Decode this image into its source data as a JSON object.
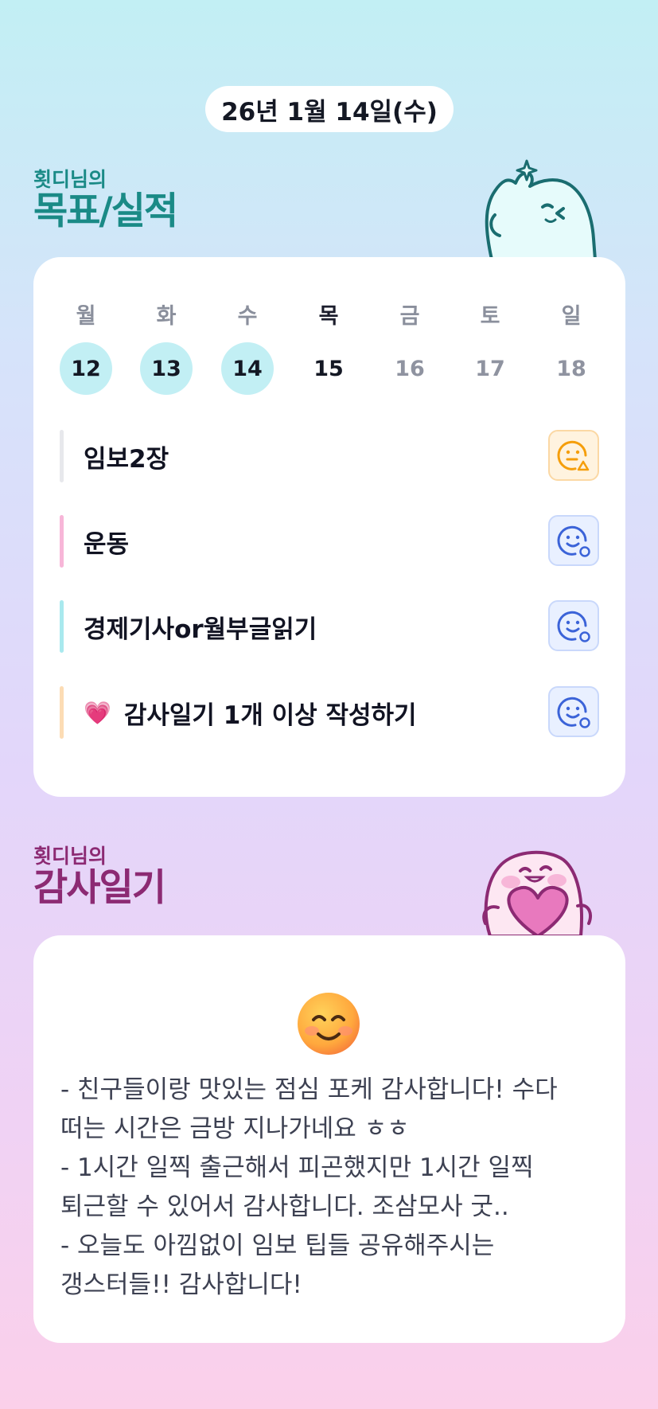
{
  "header": {
    "date": "26년 1월 14일(수)"
  },
  "goals_section": {
    "owner": "횟디님의",
    "title": "목표/실적"
  },
  "week": {
    "days": [
      {
        "name": "월",
        "num": "12",
        "state": "done"
      },
      {
        "name": "화",
        "num": "13",
        "state": "done"
      },
      {
        "name": "수",
        "num": "14",
        "state": "done"
      },
      {
        "name": "목",
        "num": "15",
        "state": "today"
      },
      {
        "name": "금",
        "num": "16",
        "state": "future"
      },
      {
        "name": "토",
        "num": "17",
        "state": "future"
      },
      {
        "name": "일",
        "num": "18",
        "state": "future"
      }
    ]
  },
  "goals": [
    {
      "label": "임보2장",
      "bar_color": "#e7e8ec",
      "status": "warning",
      "status_icon": "face-warning-icon"
    },
    {
      "label": "운동",
      "bar_color": "#f7b6d8",
      "status": "ok",
      "status_icon": "face-ok-icon"
    },
    {
      "label": "경제기사or월부글읽기",
      "bar_color": "#a9e9ee",
      "status": "ok",
      "status_icon": "face-ok-icon"
    },
    {
      "label": "감사일기 1개 이상 작성하기",
      "emoji": "💗",
      "bar_color": "#fcdcb4",
      "status": "ok",
      "status_icon": "face-ok-icon"
    }
  ],
  "diary_section": {
    "owner": "횟디님의",
    "title": "감사일기"
  },
  "diary": {
    "emoji": "smiling-face-icon",
    "text": "- 친구들이랑 맛있는 점심 포케 감사합니다! 수다 떠는 시간은 금방 지나가네요 ㅎㅎ\n- 1시간 일찍 출근해서 피곤했지만 1시간 일찍 퇴근할 수 있어서 감사합니다. 조삼모사 굿..\n- 오늘도 아낌없이 임보 팁들 공유해주시는 갱스터들!! 감사합니다!"
  },
  "colors": {
    "goals_title": "#1a8a86",
    "diary_title": "#8c2a73",
    "done_circle": "#c2eff4",
    "warning": "#f59e0b",
    "ok": "#3b63d8"
  }
}
